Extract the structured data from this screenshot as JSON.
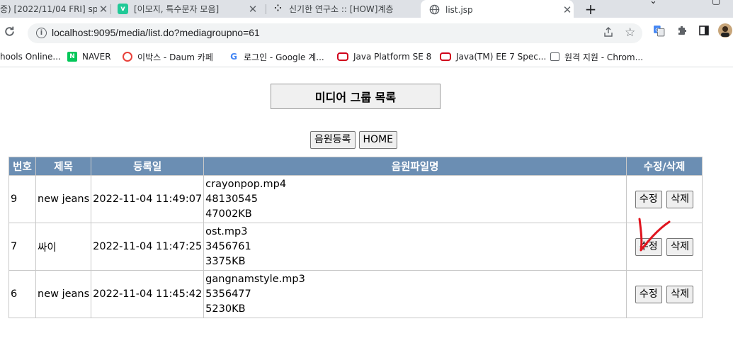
{
  "tabs": [
    {
      "title": "중) [2022/11/04 FRI] sp",
      "favicon": "doc-icon"
    },
    {
      "title": "[이모지, 특수문자 모음]",
      "favicon": "v-logo-icon"
    },
    {
      "title": "신기한 연구소 :: [HOW]계층",
      "favicon": "tistory-icon"
    },
    {
      "title": "list.jsp",
      "favicon": "globe-icon",
      "active": true
    }
  ],
  "address": {
    "url": "localhost:9095/media/list.do?mediagroupno=61"
  },
  "bookmarks": [
    {
      "label": "hools Online...",
      "icon": "",
      "color": "#ffffff"
    },
    {
      "label": "NAVER",
      "icon": "N",
      "color": "#03c75a"
    },
    {
      "label": "이박스 - Daum 카페",
      "icon": "",
      "color": "#e8413a"
    },
    {
      "label": "로그인 - Google 계...",
      "icon": "G",
      "color": "#4285f4"
    },
    {
      "label": "Java Platform SE 8",
      "icon": "",
      "color": "#d0021b"
    },
    {
      "label": "Java(TM) EE 7 Spec...",
      "icon": "",
      "color": "#d0021b"
    },
    {
      "label": "원격 지원 - Chrom...",
      "icon": "",
      "color": "#5f6368"
    }
  ],
  "page": {
    "heading": "미디어 그룹 목록",
    "register_button": "음원등록",
    "home_button": "HOME",
    "columns": [
      "번호",
      "제목",
      "등록일",
      "음원파일명",
      "수정/삭제"
    ],
    "rows": [
      {
        "no": "9",
        "title": "new jeans",
        "date": "2022-11-04 11:49:07",
        "files": [
          "crayonpop.mp4",
          "48130545",
          "47002KB"
        ]
      },
      {
        "no": "7",
        "title": "싸이",
        "date": "2022-11-04 11:47:25",
        "files": [
          "ost.mp3",
          "3456761",
          "3375KB"
        ]
      },
      {
        "no": "6",
        "title": "new jeans",
        "date": "2022-11-04 11:45:42",
        "files": [
          "gangnamstyle.mp3",
          "5356477",
          "5230KB"
        ]
      }
    ],
    "edit_button": "수정",
    "delete_button": "삭제"
  }
}
